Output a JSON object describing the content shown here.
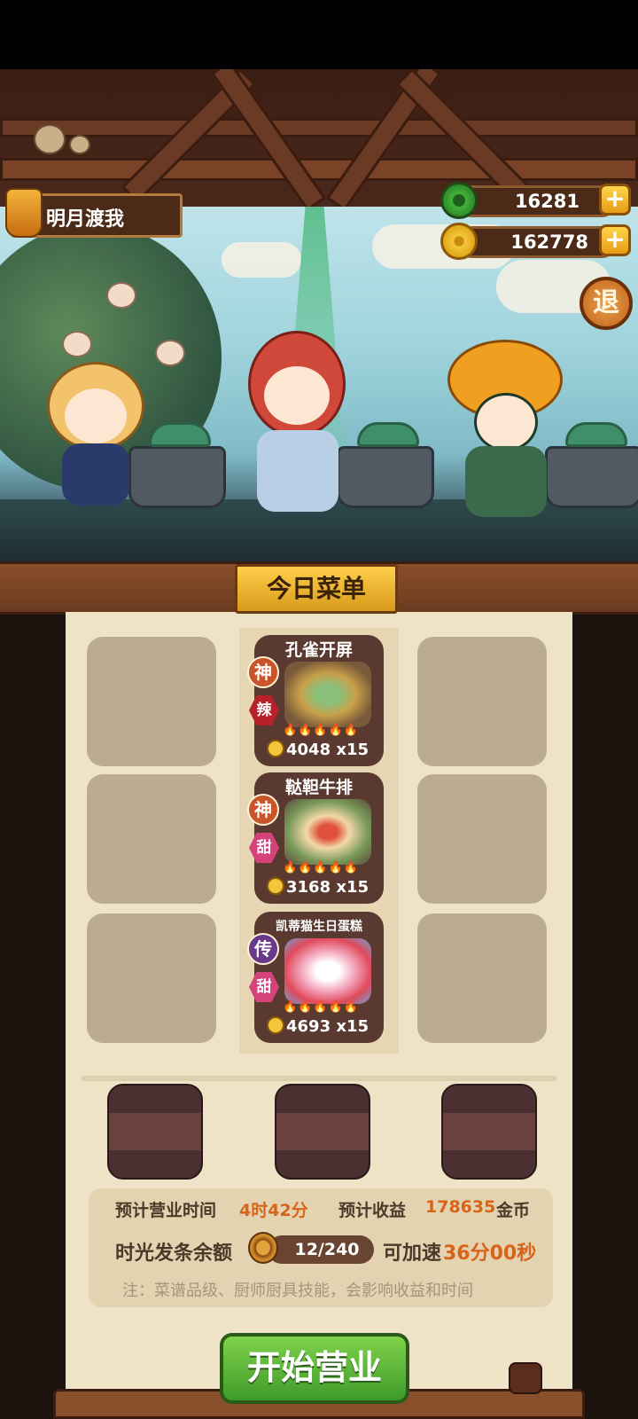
{
  "player": {
    "name": "明月渡我"
  },
  "currency": {
    "jade": {
      "value": "16281",
      "icon": "jade-icon"
    },
    "coin": {
      "value": "162778",
      "icon": "coin-icon"
    }
  },
  "exit_label": "退",
  "menu": {
    "title": "今日菜单",
    "dishes": [
      {
        "name": "孔雀开屏",
        "grade": "神",
        "taste": "辣",
        "price": "4048",
        "qty": "x15",
        "flames": "🔥🔥🔥🔥🔥"
      },
      {
        "name": "鞑靼牛排",
        "grade": "神",
        "taste": "甜",
        "price": "3168",
        "qty": "x15",
        "flames": "🔥🔥🔥🔥🔥"
      },
      {
        "name": "凯蒂猫生日蛋糕",
        "grade": "传",
        "taste": "甜",
        "price": "4693",
        "qty": "x15",
        "flames": "🔥🔥🔥🔥🔥"
      }
    ]
  },
  "info": {
    "time_label": "预计营业时间",
    "time_value": "4时42分",
    "income_label": "预计收益",
    "income_value": "178635",
    "income_unit": "金币",
    "clip_label": "时光发条余额",
    "clip_value": "12/240",
    "speed_label": "可加速",
    "speed_value": "36分00秒",
    "note": "注：菜谱品级、厨师厨具技能，会影响收益和时间"
  },
  "start_button": "开始营业",
  "colors": {
    "accent_orange": "#d8641a",
    "button_green": "#3f9a2a",
    "panel": "#efe3c7"
  }
}
